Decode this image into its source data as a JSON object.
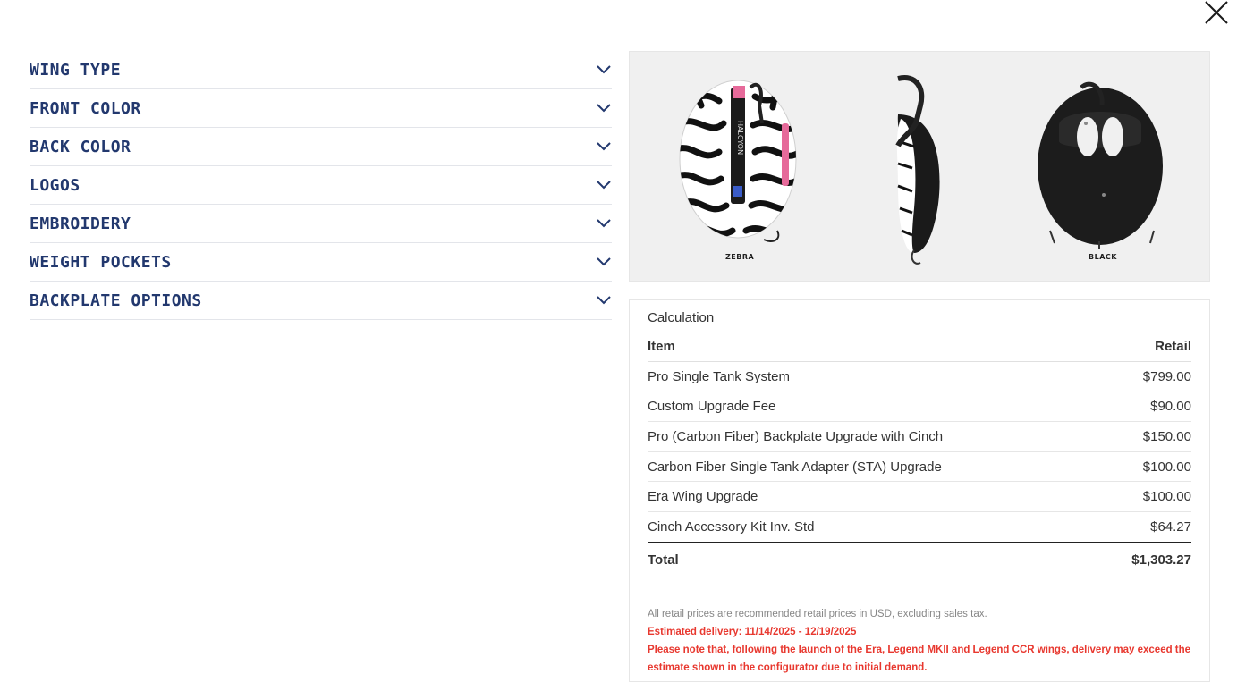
{
  "close": {
    "icon": "close-icon"
  },
  "accordion": {
    "items": [
      {
        "label": "WING TYPE"
      },
      {
        "label": "FRONT COLOR"
      },
      {
        "label": "BACK COLOR"
      },
      {
        "label": "LOGOS"
      },
      {
        "label": "EMBROIDERY"
      },
      {
        "label": "WEIGHT POCKETS"
      },
      {
        "label": "BACKPLATE OPTIONS"
      }
    ],
    "chevron_icon": "chevron-down-icon"
  },
  "product_image": {
    "front_caption": "ZEBRA",
    "back_caption": "BLACK",
    "brand_text": "HALCYON"
  },
  "calculation": {
    "title": "Calculation",
    "header": {
      "item": "Item",
      "retail": "Retail"
    },
    "rows": [
      {
        "item": "Pro Single Tank System",
        "price": "$799.00"
      },
      {
        "item": "Custom Upgrade Fee",
        "price": "$90.00"
      },
      {
        "item": "Pro (Carbon Fiber) Backplate Upgrade with Cinch",
        "price": "$150.00"
      },
      {
        "item": "Carbon Fiber Single Tank Adapter (STA) Upgrade",
        "price": "$100.00"
      },
      {
        "item": "Era Wing Upgrade",
        "price": "$100.00"
      },
      {
        "item": "Cinch Accessory Kit Inv. Std",
        "price": "$64.27"
      }
    ],
    "total": {
      "label": "Total",
      "price": "$1,303.27"
    },
    "notes": {
      "disclaimer": "All retail prices are recommended retail prices in USD, excluding sales tax.",
      "delivery": "Estimated delivery: 11/14/2025 - 12/19/2025",
      "warning": "Please note that, following the launch of the Era, Legend MKII and Legend CCR wings, delivery may exceed the estimate shown in the configurator due to initial demand."
    }
  },
  "colors": {
    "accent_navy": "#22386e",
    "warning_red": "#e8382f",
    "brand_pink": "#e66a9a"
  }
}
